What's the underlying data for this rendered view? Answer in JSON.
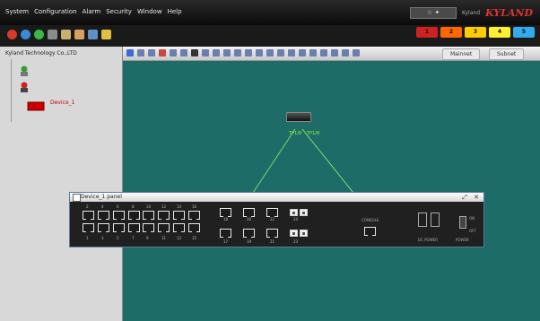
{
  "menu": [
    "System",
    "Configuration",
    "Alarm",
    "Security",
    "Window",
    "Help"
  ],
  "zoom": "☆ ✦",
  "user": "Kyland",
  "brand": "KYLAND",
  "alarms": [
    {
      "label": "1",
      "color": "#cc2222"
    },
    {
      "label": "2",
      "color": "#ff6600"
    },
    {
      "label": "3",
      "color": "#ffcc00"
    },
    {
      "label": "4",
      "color": "#ffee33"
    },
    {
      "label": "5",
      "color": "#33aaee"
    }
  ],
  "tree": {
    "root": "Kyland Technology Co.,LTD",
    "device": "Device_1"
  },
  "views": [
    "Mainnet",
    "Subnet"
  ],
  "switch": {
    "label_left": "TP1/8",
    "label_right": "TP1/8"
  },
  "panel": {
    "title": "Device_1 panel",
    "ports_top": [
      "2",
      "4",
      "6",
      "8",
      "10",
      "12",
      "14",
      "16"
    ],
    "ports_bottom": [
      "1",
      "3",
      "5",
      "7",
      "9",
      "11",
      "13",
      "15"
    ],
    "gig_top": [
      "18",
      "20",
      "22",
      "24"
    ],
    "gig_bottom": [
      "17",
      "19",
      "21",
      "23"
    ],
    "console": "CONSOLE",
    "dc_label": "DC POWER",
    "power_label": "POWER",
    "on": "ON",
    "off": "OFF"
  },
  "colors": {
    "canvas": "#1d6c68",
    "link": "#7fd76a",
    "panel_border": "#5a7aa0"
  }
}
